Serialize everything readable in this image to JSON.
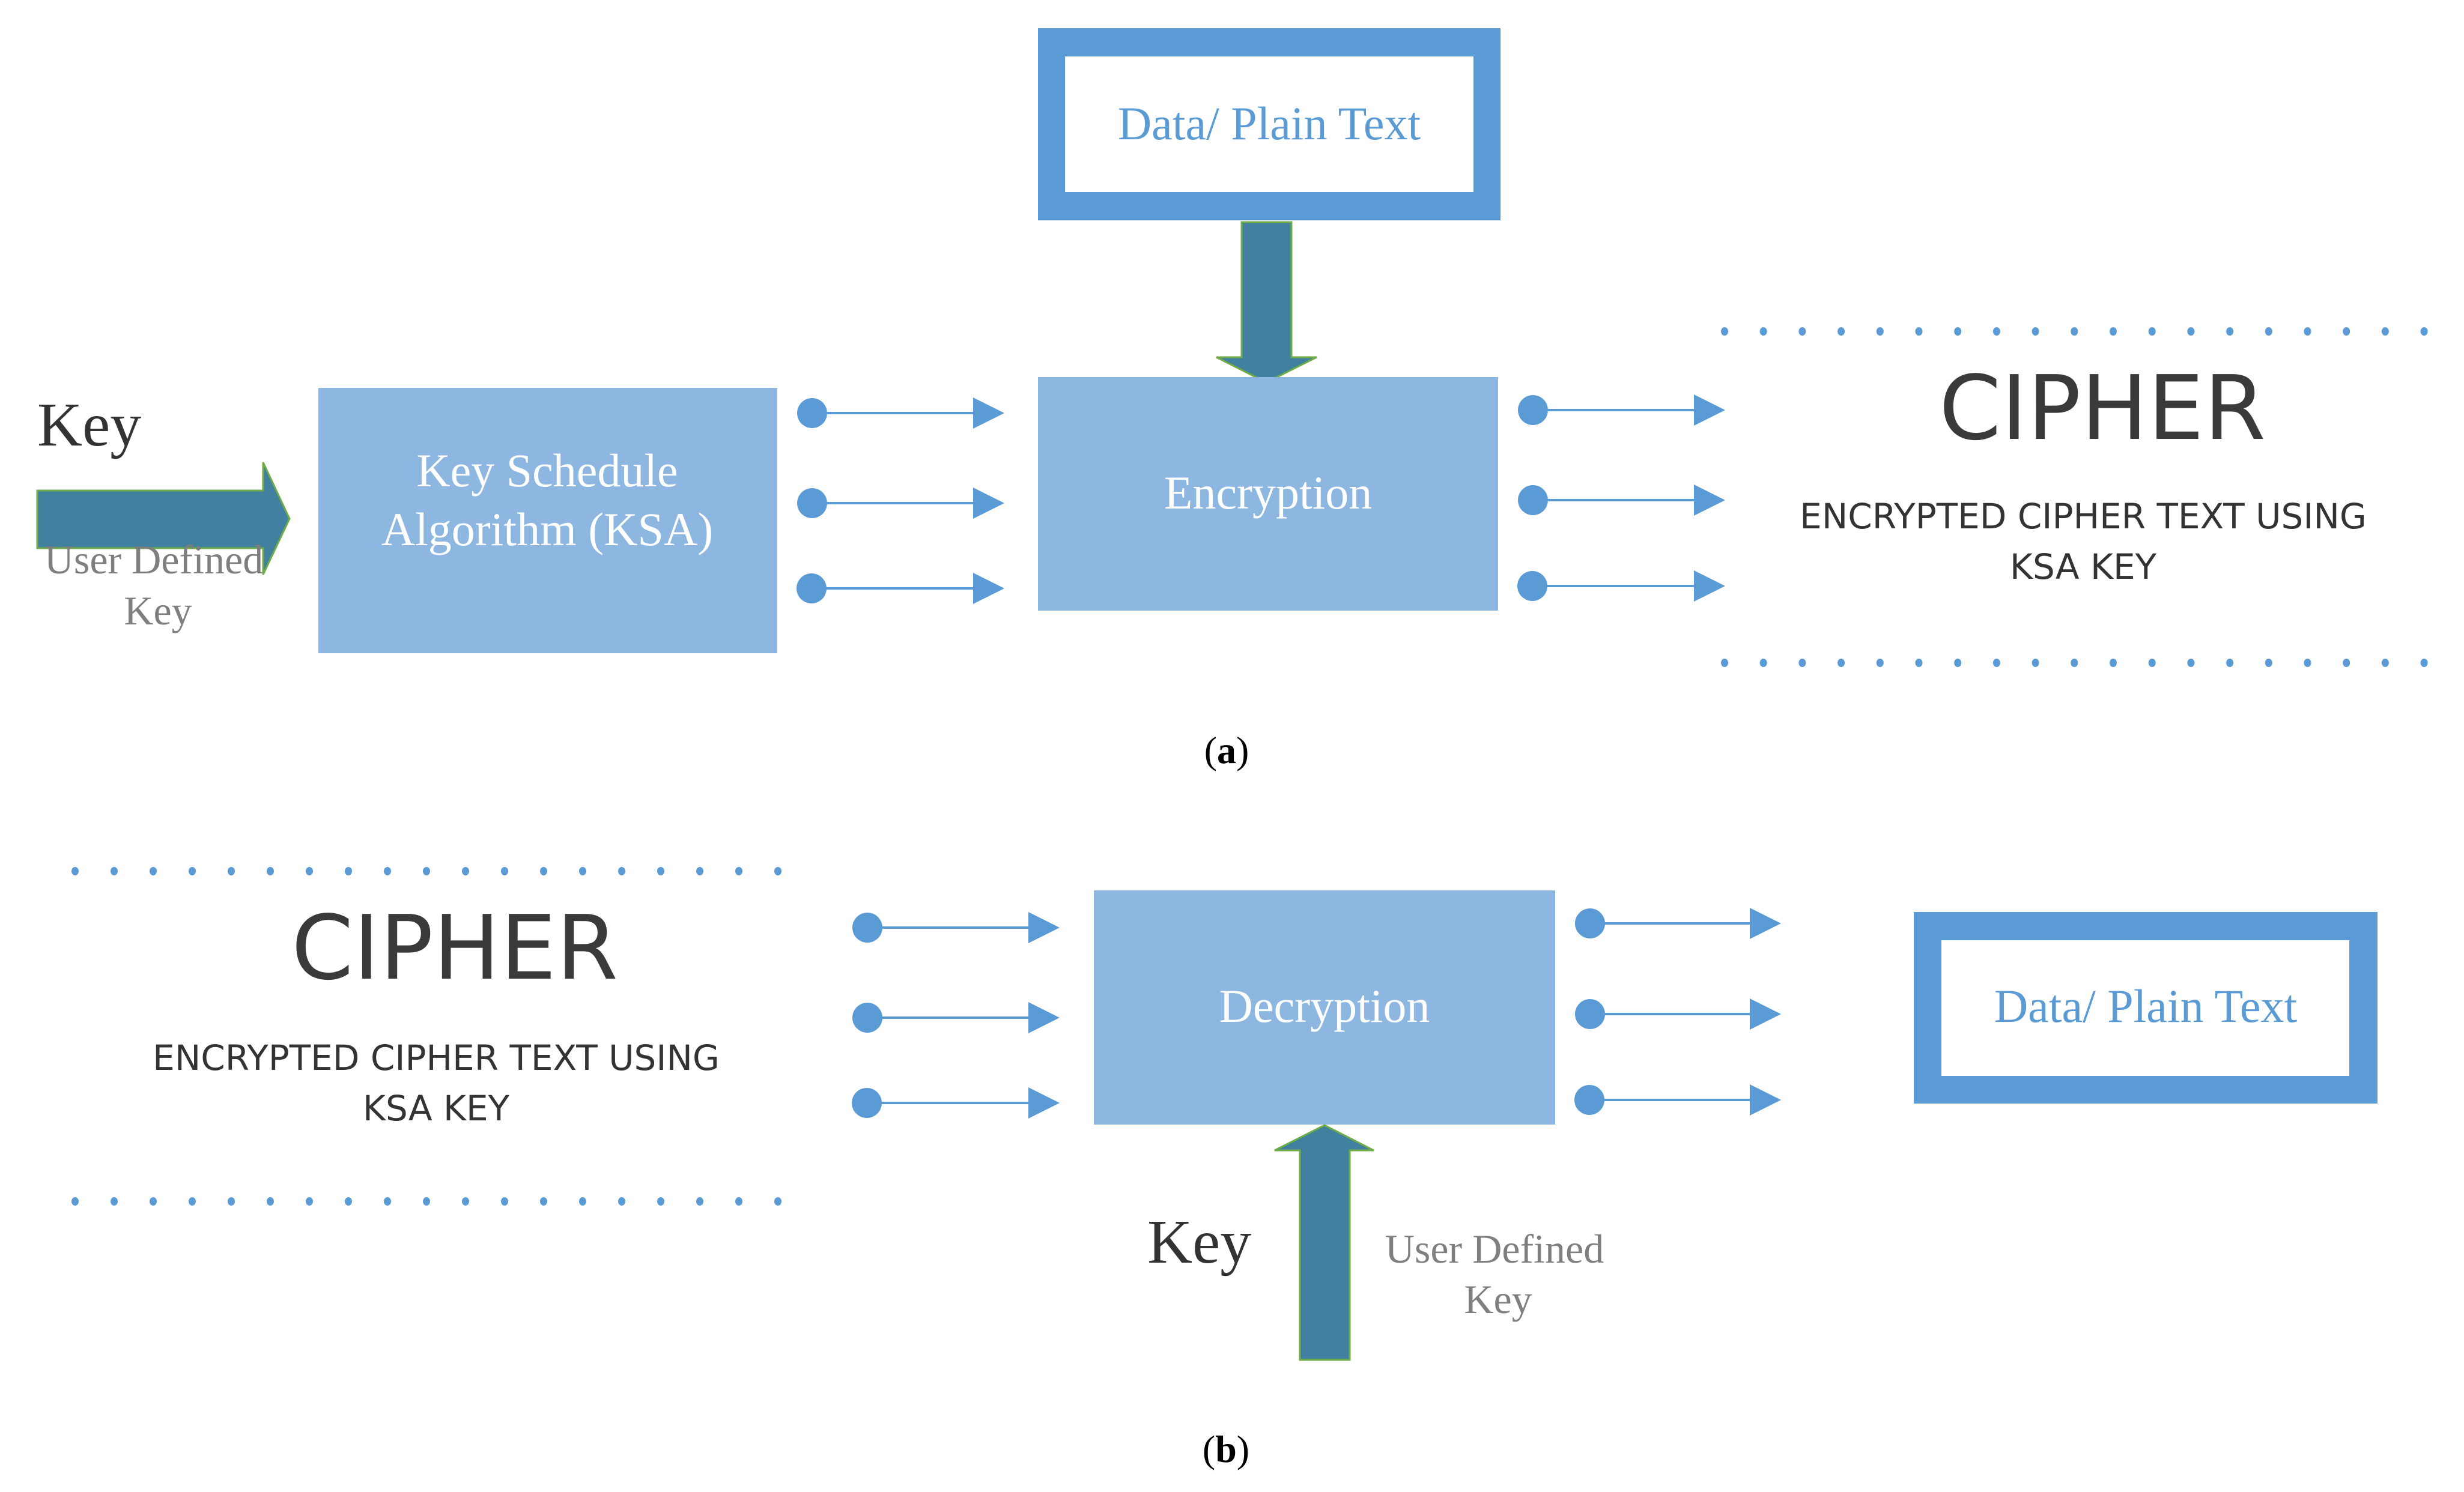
{
  "figure": {
    "panel_a": {
      "caption_letter": "a",
      "key_label": "Key",
      "user_key_label": [
        "User Defined",
        "Key"
      ],
      "ksa_box": [
        "Key Schedule",
        "Algorithm (KSA)"
      ],
      "data_box": "Data/ Plain Text",
      "process_box": "Encryption",
      "cipher": {
        "title": "CIPHER",
        "subtitle": [
          "ENCRYPTED CIPHER TEXT USING",
          "KSA KEY"
        ]
      }
    },
    "panel_b": {
      "caption_letter": "b",
      "cipher": {
        "title": "CIPHER",
        "subtitle": [
          "ENCRYPTED CIPHER TEXT USING",
          "KSA KEY"
        ]
      },
      "process_box": "Decryption",
      "data_box": "Data/ Plain Text",
      "key_label": "Key",
      "user_key_label": [
        "User Defined",
        "Key"
      ]
    },
    "colors": {
      "process_box": "#8DB7E0",
      "data_frame": "#5B9BD5",
      "connector": "#5B9BD5",
      "key_arrow": "#41819F",
      "key_arrow_outline": "#70AD47",
      "text_dark": "#333333",
      "text_gray": "#7F7F7F"
    }
  }
}
